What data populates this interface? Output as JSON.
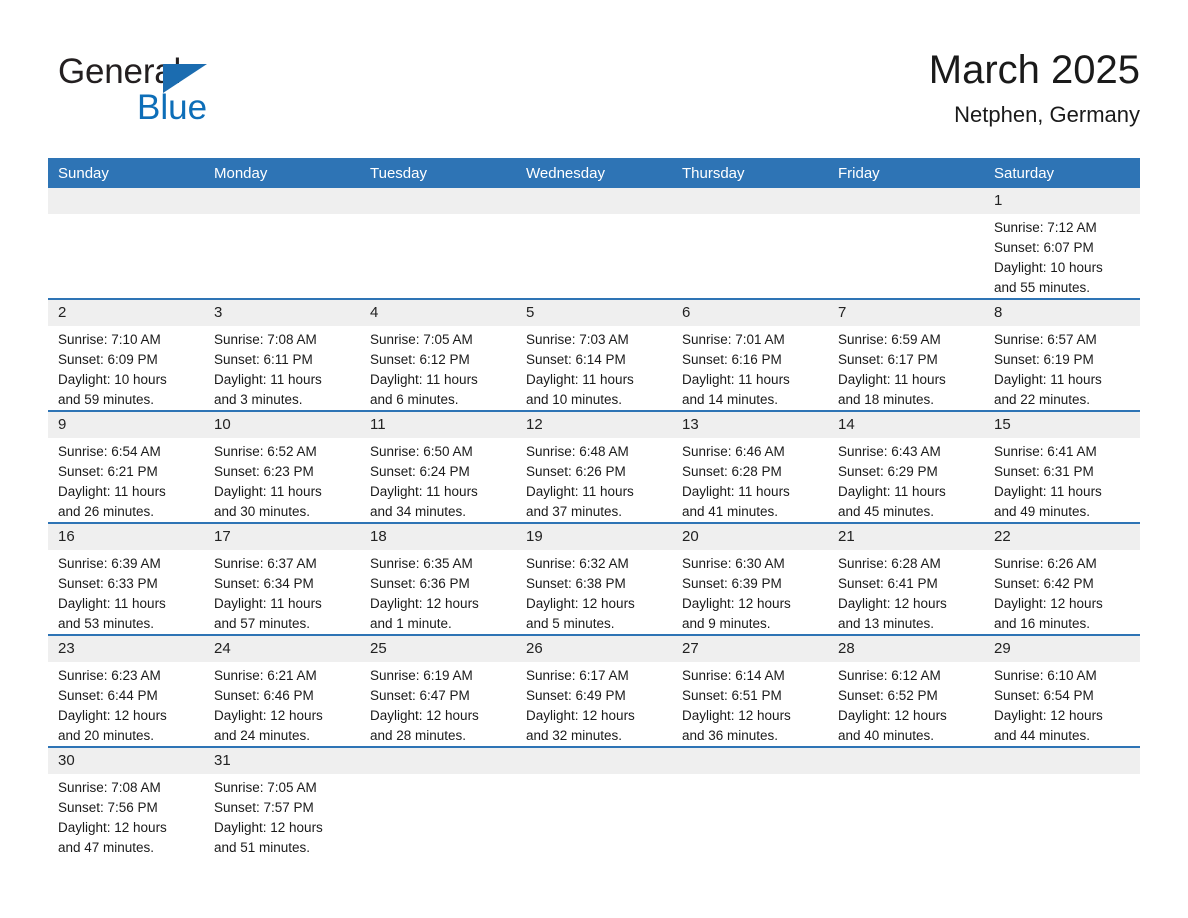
{
  "brand": {
    "logo_text_primary": "General",
    "logo_text_secondary": "Blue",
    "triangle_color": "#1b6cb0",
    "primary_color": "#0d6eb8",
    "header_color": "#2e74b5",
    "band_color": "#efefef"
  },
  "header": {
    "month_title": "March 2025",
    "location": "Netphen, Germany"
  },
  "weekdays": [
    "Sunday",
    "Monday",
    "Tuesday",
    "Wednesday",
    "Thursday",
    "Friday",
    "Saturday"
  ],
  "weeks": [
    [
      {
        "empty": true
      },
      {
        "empty": true
      },
      {
        "empty": true
      },
      {
        "empty": true
      },
      {
        "empty": true
      },
      {
        "empty": true
      },
      {
        "empty": false,
        "day": "1",
        "sunrise": "Sunrise: 7:12 AM",
        "sunset": "Sunset: 6:07 PM",
        "daylight_line1": "Daylight: 10 hours",
        "daylight_line2": "and 55 minutes."
      }
    ],
    [
      {
        "empty": false,
        "day": "2",
        "sunrise": "Sunrise: 7:10 AM",
        "sunset": "Sunset: 6:09 PM",
        "daylight_line1": "Daylight: 10 hours",
        "daylight_line2": "and 59 minutes."
      },
      {
        "empty": false,
        "day": "3",
        "sunrise": "Sunrise: 7:08 AM",
        "sunset": "Sunset: 6:11 PM",
        "daylight_line1": "Daylight: 11 hours",
        "daylight_line2": "and 3 minutes."
      },
      {
        "empty": false,
        "day": "4",
        "sunrise": "Sunrise: 7:05 AM",
        "sunset": "Sunset: 6:12 PM",
        "daylight_line1": "Daylight: 11 hours",
        "daylight_line2": "and 6 minutes."
      },
      {
        "empty": false,
        "day": "5",
        "sunrise": "Sunrise: 7:03 AM",
        "sunset": "Sunset: 6:14 PM",
        "daylight_line1": "Daylight: 11 hours",
        "daylight_line2": "and 10 minutes."
      },
      {
        "empty": false,
        "day": "6",
        "sunrise": "Sunrise: 7:01 AM",
        "sunset": "Sunset: 6:16 PM",
        "daylight_line1": "Daylight: 11 hours",
        "daylight_line2": "and 14 minutes."
      },
      {
        "empty": false,
        "day": "7",
        "sunrise": "Sunrise: 6:59 AM",
        "sunset": "Sunset: 6:17 PM",
        "daylight_line1": "Daylight: 11 hours",
        "daylight_line2": "and 18 minutes."
      },
      {
        "empty": false,
        "day": "8",
        "sunrise": "Sunrise: 6:57 AM",
        "sunset": "Sunset: 6:19 PM",
        "daylight_line1": "Daylight: 11 hours",
        "daylight_line2": "and 22 minutes."
      }
    ],
    [
      {
        "empty": false,
        "day": "9",
        "sunrise": "Sunrise: 6:54 AM",
        "sunset": "Sunset: 6:21 PM",
        "daylight_line1": "Daylight: 11 hours",
        "daylight_line2": "and 26 minutes."
      },
      {
        "empty": false,
        "day": "10",
        "sunrise": "Sunrise: 6:52 AM",
        "sunset": "Sunset: 6:23 PM",
        "daylight_line1": "Daylight: 11 hours",
        "daylight_line2": "and 30 minutes."
      },
      {
        "empty": false,
        "day": "11",
        "sunrise": "Sunrise: 6:50 AM",
        "sunset": "Sunset: 6:24 PM",
        "daylight_line1": "Daylight: 11 hours",
        "daylight_line2": "and 34 minutes."
      },
      {
        "empty": false,
        "day": "12",
        "sunrise": "Sunrise: 6:48 AM",
        "sunset": "Sunset: 6:26 PM",
        "daylight_line1": "Daylight: 11 hours",
        "daylight_line2": "and 37 minutes."
      },
      {
        "empty": false,
        "day": "13",
        "sunrise": "Sunrise: 6:46 AM",
        "sunset": "Sunset: 6:28 PM",
        "daylight_line1": "Daylight: 11 hours",
        "daylight_line2": "and 41 minutes."
      },
      {
        "empty": false,
        "day": "14",
        "sunrise": "Sunrise: 6:43 AM",
        "sunset": "Sunset: 6:29 PM",
        "daylight_line1": "Daylight: 11 hours",
        "daylight_line2": "and 45 minutes."
      },
      {
        "empty": false,
        "day": "15",
        "sunrise": "Sunrise: 6:41 AM",
        "sunset": "Sunset: 6:31 PM",
        "daylight_line1": "Daylight: 11 hours",
        "daylight_line2": "and 49 minutes."
      }
    ],
    [
      {
        "empty": false,
        "day": "16",
        "sunrise": "Sunrise: 6:39 AM",
        "sunset": "Sunset: 6:33 PM",
        "daylight_line1": "Daylight: 11 hours",
        "daylight_line2": "and 53 minutes."
      },
      {
        "empty": false,
        "day": "17",
        "sunrise": "Sunrise: 6:37 AM",
        "sunset": "Sunset: 6:34 PM",
        "daylight_line1": "Daylight: 11 hours",
        "daylight_line2": "and 57 minutes."
      },
      {
        "empty": false,
        "day": "18",
        "sunrise": "Sunrise: 6:35 AM",
        "sunset": "Sunset: 6:36 PM",
        "daylight_line1": "Daylight: 12 hours",
        "daylight_line2": "and 1 minute."
      },
      {
        "empty": false,
        "day": "19",
        "sunrise": "Sunrise: 6:32 AM",
        "sunset": "Sunset: 6:38 PM",
        "daylight_line1": "Daylight: 12 hours",
        "daylight_line2": "and 5 minutes."
      },
      {
        "empty": false,
        "day": "20",
        "sunrise": "Sunrise: 6:30 AM",
        "sunset": "Sunset: 6:39 PM",
        "daylight_line1": "Daylight: 12 hours",
        "daylight_line2": "and 9 minutes."
      },
      {
        "empty": false,
        "day": "21",
        "sunrise": "Sunrise: 6:28 AM",
        "sunset": "Sunset: 6:41 PM",
        "daylight_line1": "Daylight: 12 hours",
        "daylight_line2": "and 13 minutes."
      },
      {
        "empty": false,
        "day": "22",
        "sunrise": "Sunrise: 6:26 AM",
        "sunset": "Sunset: 6:42 PM",
        "daylight_line1": "Daylight: 12 hours",
        "daylight_line2": "and 16 minutes."
      }
    ],
    [
      {
        "empty": false,
        "day": "23",
        "sunrise": "Sunrise: 6:23 AM",
        "sunset": "Sunset: 6:44 PM",
        "daylight_line1": "Daylight: 12 hours",
        "daylight_line2": "and 20 minutes."
      },
      {
        "empty": false,
        "day": "24",
        "sunrise": "Sunrise: 6:21 AM",
        "sunset": "Sunset: 6:46 PM",
        "daylight_line1": "Daylight: 12 hours",
        "daylight_line2": "and 24 minutes."
      },
      {
        "empty": false,
        "day": "25",
        "sunrise": "Sunrise: 6:19 AM",
        "sunset": "Sunset: 6:47 PM",
        "daylight_line1": "Daylight: 12 hours",
        "daylight_line2": "and 28 minutes."
      },
      {
        "empty": false,
        "day": "26",
        "sunrise": "Sunrise: 6:17 AM",
        "sunset": "Sunset: 6:49 PM",
        "daylight_line1": "Daylight: 12 hours",
        "daylight_line2": "and 32 minutes."
      },
      {
        "empty": false,
        "day": "27",
        "sunrise": "Sunrise: 6:14 AM",
        "sunset": "Sunset: 6:51 PM",
        "daylight_line1": "Daylight: 12 hours",
        "daylight_line2": "and 36 minutes."
      },
      {
        "empty": false,
        "day": "28",
        "sunrise": "Sunrise: 6:12 AM",
        "sunset": "Sunset: 6:52 PM",
        "daylight_line1": "Daylight: 12 hours",
        "daylight_line2": "and 40 minutes."
      },
      {
        "empty": false,
        "day": "29",
        "sunrise": "Sunrise: 6:10 AM",
        "sunset": "Sunset: 6:54 PM",
        "daylight_line1": "Daylight: 12 hours",
        "daylight_line2": "and 44 minutes."
      }
    ],
    [
      {
        "empty": false,
        "day": "30",
        "sunrise": "Sunrise: 7:08 AM",
        "sunset": "Sunset: 7:56 PM",
        "daylight_line1": "Daylight: 12 hours",
        "daylight_line2": "and 47 minutes."
      },
      {
        "empty": false,
        "day": "31",
        "sunrise": "Sunrise: 7:05 AM",
        "sunset": "Sunset: 7:57 PM",
        "daylight_line1": "Daylight: 12 hours",
        "daylight_line2": "and 51 minutes."
      },
      {
        "empty": true
      },
      {
        "empty": true
      },
      {
        "empty": true
      },
      {
        "empty": true
      },
      {
        "empty": true
      }
    ]
  ]
}
